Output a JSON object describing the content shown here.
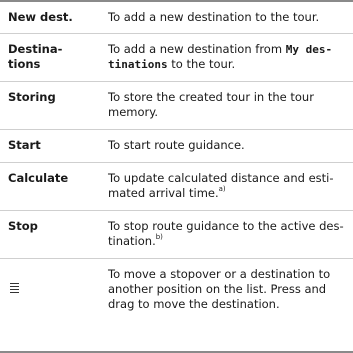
{
  "rows": [
    {
      "key": "New dest.",
      "desc": "To add a new destination to the tour."
    },
    {
      "key_line1": "Destina-",
      "key_line2": "tions",
      "desc_line1_prefix": "To add a new destination from ",
      "desc_code_line1": "My des-",
      "desc_code_line2": "tinations",
      "desc_line2_suffix": " to the tour."
    },
    {
      "key": "Storing",
      "desc_line1": "To store the created tour in the tour",
      "desc_line2": "memory."
    },
    {
      "key": "Start",
      "desc": "To start route guidance."
    },
    {
      "key": "Calculate",
      "desc_line1": "To update calculated distance and esti-",
      "desc_line2": "mated arrival time.",
      "footnote": "a)"
    },
    {
      "key": "Stop",
      "desc_line1": "To stop route guidance to the active des-",
      "desc_line2": "tination.",
      "footnote": "b)"
    },
    {
      "icon": "drag-handle-icon",
      "desc_line1": "To move a stopover or a destination to",
      "desc_line2": "another position on the list. Press and",
      "desc_line3": "drag to move the destination."
    }
  ]
}
